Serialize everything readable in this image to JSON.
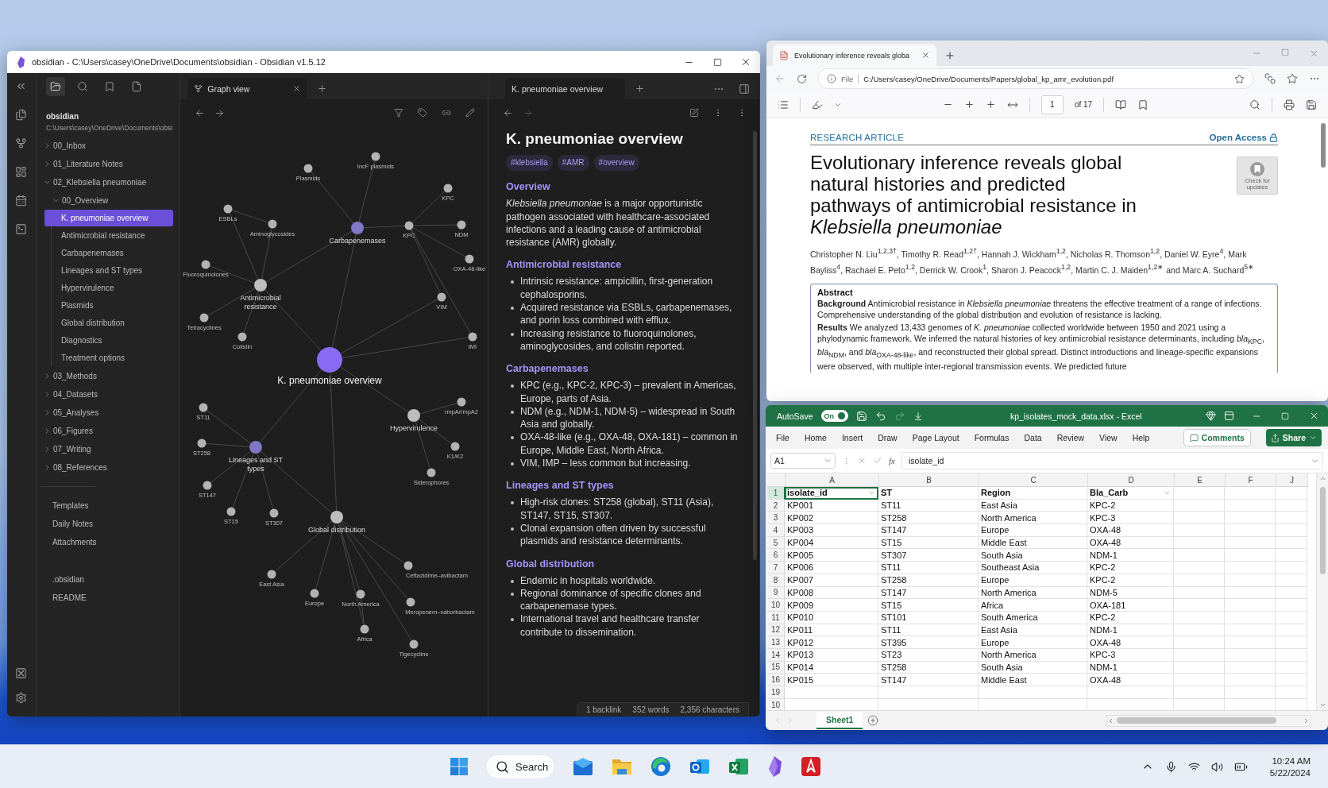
{
  "obsidian": {
    "title": "obsidian - C:\\Users\\casey\\OneDrive\\Documents\\obsidian - Obsidian v1.5.12",
    "sidebar_tabs": [
      {
        "kind": "files",
        "selected": true
      },
      {
        "kind": "search",
        "selected": false
      },
      {
        "kind": "bookmarks",
        "selected": false
      },
      {
        "kind": "outline",
        "selected": false
      }
    ],
    "vault_name": "obsidian",
    "vault_path": "C:\\Users\\casey\\OneDrive\\Documents\\obsi",
    "tree": [
      {
        "label": "00_Inbox",
        "kind": "folder",
        "expanded": false,
        "selected": false
      },
      {
        "label": "01_Literature Notes",
        "kind": "folder",
        "expanded": false,
        "selected": false
      },
      {
        "label": "02_Klebsiella pneumoniae",
        "kind": "folder",
        "expanded": true,
        "selected": false,
        "children": [
          {
            "label": "00_Overview",
            "kind": "folder",
            "expanded": true,
            "selected": false,
            "children": [
              {
                "label": "K. pneumoniae overview",
                "kind": "note",
                "selected": true
              },
              {
                "label": "Antimicrobial resistance",
                "kind": "note",
                "selected": false
              },
              {
                "label": "Carbapenemases",
                "kind": "note",
                "selected": false
              },
              {
                "label": "Lineages and ST types",
                "kind": "note",
                "selected": false
              },
              {
                "label": "Hypervirulence",
                "kind": "note",
                "selected": false
              },
              {
                "label": "Plasmids",
                "kind": "note",
                "selected": false
              },
              {
                "label": "Global distribution",
                "kind": "note",
                "selected": false
              },
              {
                "label": "Diagnostics",
                "kind": "note",
                "selected": false
              },
              {
                "label": "Treatment options",
                "kind": "note",
                "selected": false
              }
            ]
          }
        ]
      },
      {
        "label": "03_Methods",
        "kind": "folder",
        "expanded": false,
        "selected": false
      },
      {
        "label": "04_Datasets",
        "kind": "folder",
        "expanded": false,
        "selected": false
      },
      {
        "label": "05_Analyses",
        "kind": "folder",
        "expanded": false,
        "selected": false
      },
      {
        "label": "06_Figures",
        "kind": "folder",
        "expanded": false,
        "selected": false
      },
      {
        "label": "07_Writing",
        "kind": "folder",
        "expanded": false,
        "selected": false
      },
      {
        "label": "08_References",
        "kind": "folder",
        "expanded": false,
        "selected": false
      }
    ],
    "other_items": [
      {
        "label": "Templates",
        "kind": "note",
        "selected": false
      },
      {
        "label": "Daily Notes",
        "kind": "note",
        "selected": false
      },
      {
        "label": "Attachments",
        "kind": "note",
        "selected": false
      }
    ],
    "root_files": [
      {
        "label": ".obsidian",
        "kind": "note",
        "selected": false
      },
      {
        "label": "README",
        "kind": "note",
        "selected": false
      }
    ],
    "graph_tab": "Graph view",
    "graph": {
      "nodes": [
        {
          "label": "IncF plasmids",
          "kind": "leaf"
        },
        {
          "label": "Plasmids",
          "kind": "leaf"
        },
        {
          "label": "KPC",
          "kind": "leaf"
        },
        {
          "label": "ESBLs",
          "kind": "leaf"
        },
        {
          "label": "Aminoglycosides",
          "kind": "leaf"
        },
        {
          "label": "Carbapenemases",
          "kind": "linked"
        },
        {
          "label": "KPC",
          "kind": "leaf"
        },
        {
          "label": "NDM",
          "kind": "leaf"
        },
        {
          "label": "Fluoroquinolones",
          "kind": "leaf"
        },
        {
          "label": "OXA-48-like",
          "kind": "leaf"
        },
        {
          "label": "Antimicrobial resistance",
          "kind": "hub"
        },
        {
          "label": "VIM",
          "kind": "leaf"
        },
        {
          "label": "Tetracyclines",
          "kind": "leaf"
        },
        {
          "label": "Colistin",
          "kind": "leaf"
        },
        {
          "label": "IMI",
          "kind": "leaf"
        },
        {
          "label": "K. pneumoniae overview",
          "kind": "current"
        },
        {
          "label": "ST11",
          "kind": "leaf"
        },
        {
          "label": "Hypervirulence",
          "kind": "hub"
        },
        {
          "label": "rmpA/rmpA2",
          "kind": "leaf"
        },
        {
          "label": "ST258",
          "kind": "leaf"
        },
        {
          "label": "Lineages and ST types",
          "kind": "linked"
        },
        {
          "label": "K1/K2",
          "kind": "leaf"
        },
        {
          "label": "Siderophores",
          "kind": "leaf"
        },
        {
          "label": "ST147",
          "kind": "leaf"
        },
        {
          "label": "ST15",
          "kind": "leaf"
        },
        {
          "label": "ST307",
          "kind": "leaf"
        },
        {
          "label": "Global distribution",
          "kind": "hub"
        },
        {
          "label": "Ceftazidime–avibactam",
          "kind": "leaf"
        },
        {
          "label": "East Asia",
          "kind": "leaf"
        },
        {
          "label": "Europe",
          "kind": "leaf"
        },
        {
          "label": "North America",
          "kind": "leaf"
        },
        {
          "label": "Meropenem–vaborbactam",
          "kind": "leaf"
        },
        {
          "label": "Africa",
          "kind": "leaf"
        },
        {
          "label": "Tigecycline",
          "kind": "leaf"
        }
      ]
    },
    "note_tab": "K. pneumoniae overview",
    "note": {
      "title": "K. pneumoniae overview",
      "tags": [
        "#klebsiella",
        "#AMR",
        "#overview"
      ],
      "sections": [
        {
          "heading": "Overview",
          "kind": "paragraph",
          "text": "*Klebsiella pneumoniae* is a major opportunistic pathogen associated with healthcare-associated infections and a leading cause of antimicrobial resistance (AMR) globally."
        },
        {
          "heading": "Antimicrobial resistance",
          "kind": "bullets",
          "items": [
            "Intrinsic resistance: ampicillin, first-generation cephalosporins.",
            "Acquired resistance via ESBLs, carbapenemases, and porin loss combined with efflux.",
            "Increasing resistance to fluoroquinolones, aminoglycosides, and colistin reported."
          ]
        },
        {
          "heading": "Carbapenemases",
          "kind": "bullets",
          "items": [
            "KPC (e.g., KPC-2, KPC-3) – prevalent in Americas, Europe, parts of Asia.",
            "NDM (e.g., NDM-1, NDM-5) – widespread in South Asia and globally.",
            "OXA-48-like (e.g., OXA-48, OXA-181) – common in Europe, Middle East, North Africa.",
            "VIM, IMP – less common but increasing."
          ]
        },
        {
          "heading": "Lineages and ST types",
          "kind": "bullets",
          "items": [
            "High-risk clones: ST258 (global), ST11 (Asia), ST147, ST15, ST307.",
            "Clonal expansion often driven by successful plasmids and resistance determinants."
          ]
        },
        {
          "heading": "Global distribution",
          "kind": "bullets",
          "items": [
            "Endemic in hospitals worldwide.",
            "Regional dominance of specific clones and carbapenemase types.",
            "International travel and healthcare transfer contribute to dissemination."
          ]
        }
      ]
    },
    "status": [
      "1 backlink",
      "352 words",
      "2,356 characters"
    ]
  },
  "pdf_viewer": {
    "tab_title": "Evolutionary inference reveals globa",
    "address_label": "File",
    "url": "C:/Users/casey/OneDrive/Documents/Papers/global_kp_amr_evolution.pdf",
    "page": "1",
    "page_count": "of 17",
    "article": {
      "type": "RESEARCH ARTICLE",
      "access": "Open Access",
      "update_badge": "Check for updates",
      "title": "Evolutionary inference reveals global natural histories and predicted pathways of antimicrobial resistance in *Klebsiella pneumoniae*",
      "authors": "Christopher N. Liu$^{1,2,3†}$, Timothy R. Read$^{1,2†}$, Hannah J. Wickham$^{1,2}$, Nicholas R. Thomson$^{1,2}$, Daniel W. Eyre$^{4}$, Mark Bayliss$^{4}$, Rachael E. Peto$^{1,2}$, Derrick W. Crook$^{1}$, Sharon J. Peacock$^{1,2}$, Martin C. J. Maiden$^{1,2∗}$ and Marc A. Suchard$^{5∗}$",
      "abstract_heading": "Abstract",
      "abstract": [
        "**Background** Antimicrobial resistance in *Klebsiella pneumoniae* threatens the effective treatment of a range of infections. Comprehensive understanding of the global distribution and evolution of resistance is lacking.",
        "**Results** We analyzed 13,433 genomes of *K. pneumoniae* collected worldwide between 1950 and 2021 using a phylodynamic framework. We inferred the natural histories of key antimicrobial resistance determinants, including *bla*$_{KPC}$, *bla*$_{NDM}$, and *bla*$_{OXA-48-like}$, and reconstructed their global spread. Distinct introductions and lineage-specific expansions were observed, with multiple inter-regional transmission events. We predicted future"
      ]
    }
  },
  "spreadsheet": {
    "autosave_label": "AutoSave",
    "autosave_state": "On",
    "autosave_on": true,
    "title": "kp_isolates_mock_data.xlsx - Excel",
    "menu": [
      "File",
      "Home",
      "Insert",
      "Draw",
      "Page Layout",
      "Formulas",
      "Data",
      "Review",
      "View",
      "Help"
    ],
    "comments": "Comments",
    "share": "Share",
    "name_box": "A1",
    "fx": "fx",
    "formula": "isolate_id",
    "columns": [
      "A",
      "B",
      "C",
      "D",
      "E",
      "F",
      "J"
    ],
    "rows": [
      {
        "number": "1",
        "kind": "header",
        "active": true,
        "filters": [
          true,
          false,
          false,
          true
        ],
        "cells": [
          "isolate_id",
          "ST",
          "Region",
          "Bla_Carb"
        ]
      },
      {
        "number": "2",
        "kind": "data",
        "active": false,
        "cells": [
          "KP001",
          "ST11",
          "East Asia",
          "KPC-2"
        ]
      },
      {
        "number": "3",
        "kind": "data",
        "active": false,
        "cells": [
          "KP002",
          "ST258",
          "North America",
          "KPC-3"
        ]
      },
      {
        "number": "4",
        "kind": "data",
        "active": false,
        "cells": [
          "KP003",
          "ST147",
          "Europe",
          "OXA-48"
        ]
      },
      {
        "number": "5",
        "kind": "data",
        "active": false,
        "cells": [
          "KP004",
          "ST15",
          "Middle East",
          "OXA-48"
        ]
      },
      {
        "number": "6",
        "kind": "data",
        "active": false,
        "cells": [
          "KP005",
          "ST307",
          "South Asia",
          "NDM-1"
        ]
      },
      {
        "number": "7",
        "kind": "data",
        "active": false,
        "cells": [
          "KP006",
          "ST11",
          "Southeast Asia",
          "KPC-2"
        ]
      },
      {
        "number": "8",
        "kind": "data",
        "active": false,
        "cells": [
          "KP007",
          "ST258",
          "Europe",
          "KPC-2"
        ]
      },
      {
        "number": "9",
        "kind": "data",
        "active": false,
        "cells": [
          "KP008",
          "ST147",
          "North America",
          "NDM-5"
        ]
      },
      {
        "number": "10",
        "kind": "data",
        "active": false,
        "cells": [
          "KP009",
          "ST15",
          "Africa",
          "OXA-181"
        ]
      },
      {
        "number": "11",
        "kind": "data",
        "active": false,
        "cells": [
          "KP010",
          "ST101",
          "South America",
          "KPC-2"
        ]
      },
      {
        "number": "12",
        "kind": "data",
        "active": false,
        "cells": [
          "KP011",
          "ST11",
          "East Asia",
          "NDM-1"
        ]
      },
      {
        "number": "13",
        "kind": "data",
        "active": false,
        "cells": [
          "KP012",
          "ST395",
          "Europe",
          "OXA-48"
        ]
      },
      {
        "number": "14",
        "kind": "data",
        "active": false,
        "cells": [
          "KP013",
          "ST23",
          "North America",
          "KPC-3"
        ]
      },
      {
        "number": "15",
        "kind": "data",
        "active": false,
        "cells": [
          "KP014",
          "ST258",
          "South Asia",
          "NDM-1"
        ]
      },
      {
        "number": "16",
        "kind": "data",
        "active": false,
        "cells": [
          "KP015",
          "ST147",
          "Middle East",
          "OXA-48"
        ]
      },
      {
        "number": "19",
        "kind": "empty",
        "active": false,
        "cells": []
      },
      {
        "number": "10",
        "kind": "empty",
        "active": false,
        "cells": []
      }
    ],
    "sheet_tabs": [
      {
        "label": "Sheet1",
        "selected": true
      }
    ]
  },
  "taskbar": {
    "search": "Search",
    "time": "10:24 AM",
    "date": "5/22/2024"
  }
}
